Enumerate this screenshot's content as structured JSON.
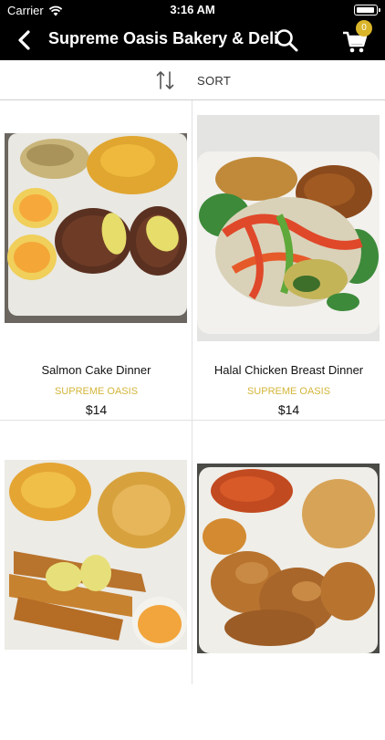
{
  "status_bar": {
    "carrier": "Carrier",
    "time": "3:16 AM"
  },
  "header": {
    "title": "Supreme Oasis Bakery & Deli",
    "cart_count": "0"
  },
  "sort": {
    "label": "SORT"
  },
  "products": [
    {
      "name": "Salmon Cake Dinner",
      "vendor": "SUPREME OASIS",
      "price": "$14"
    },
    {
      "name": "Halal Chicken Breast Dinner",
      "vendor": "SUPREME OASIS",
      "price": "$14"
    },
    {
      "name": "",
      "vendor": "",
      "price": ""
    },
    {
      "name": "",
      "vendor": "",
      "price": ""
    }
  ],
  "colors": {
    "accent": "#d4b53a",
    "header_bg": "#000000",
    "badge": "#d9b52a"
  }
}
